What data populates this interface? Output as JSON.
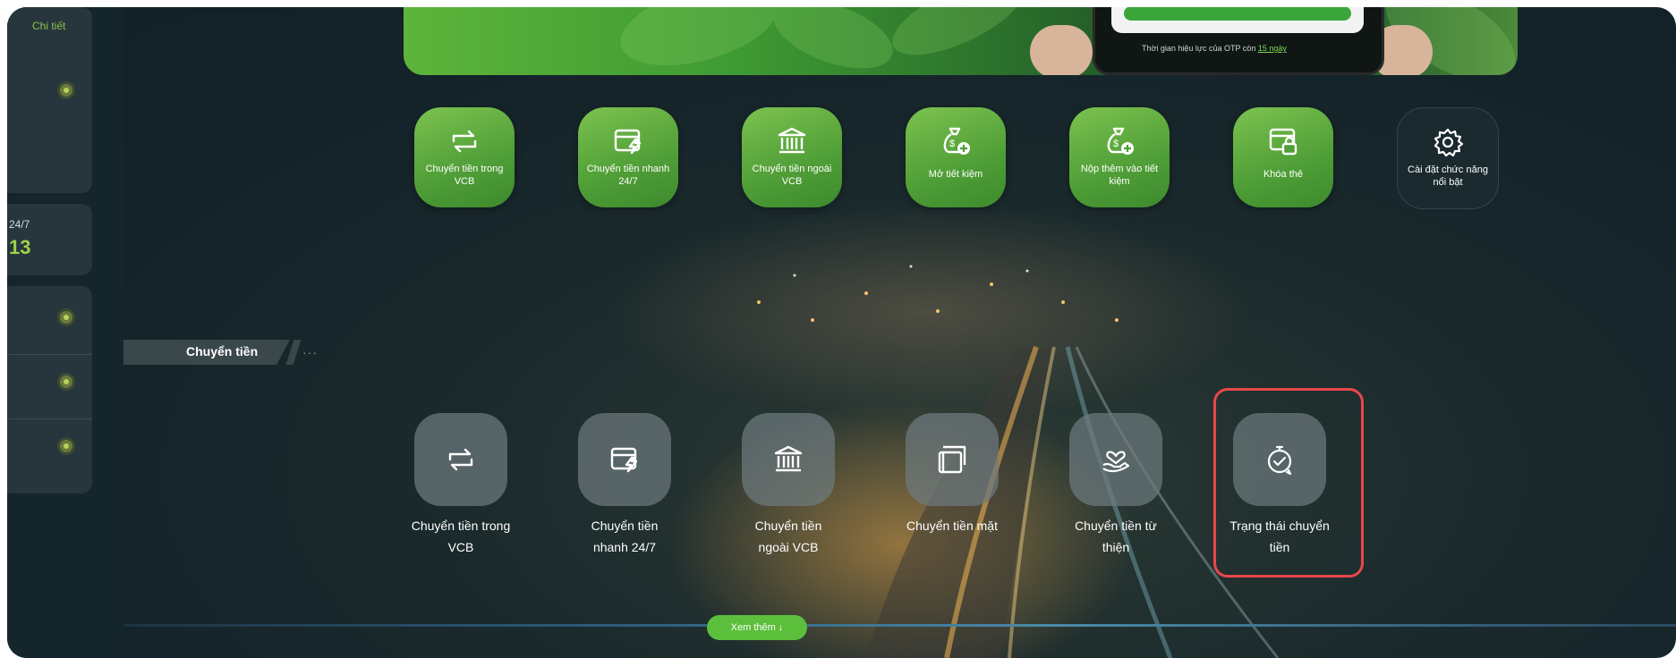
{
  "left_panel": {
    "detail_link": "Chi tiết",
    "label_247": "24/7",
    "value": "13"
  },
  "banner": {
    "otp_text": "Thời gian hiệu lực của OTP còn",
    "otp_time": "15 ngày"
  },
  "featured": [
    {
      "label": "Chuyển tiền trong VCB",
      "icon": "transfer-arrows-icon"
    },
    {
      "label": "Chuyển tiền nhanh 24/7",
      "icon": "fast-card-icon"
    },
    {
      "label": "Chuyển tiền ngoài VCB",
      "icon": "bank-icon"
    },
    {
      "label": "Mở tiết kiệm",
      "icon": "savings-bag-plus-icon"
    },
    {
      "label": "Nộp thêm vào tiết kiệm",
      "icon": "savings-bag-deposit-icon"
    },
    {
      "label": "Khóa thẻ",
      "icon": "card-lock-icon"
    },
    {
      "label": "Cài đặt chức năng nổi bật",
      "icon": "gear-icon"
    }
  ],
  "section": {
    "title": "Chuyển tiền",
    "more_dots": "···"
  },
  "transfer_items": [
    {
      "line1": "Chuyển tiền trong",
      "line2": "VCB",
      "icon": "transfer-arrows-icon"
    },
    {
      "line1": "Chuyển tiền",
      "line2": "nhanh 24/7",
      "icon": "fast-card-icon"
    },
    {
      "line1": "Chuyển tiền",
      "line2": "ngoài VCB",
      "icon": "bank-icon"
    },
    {
      "line1": "Chuyển tiền mặt",
      "line2": "",
      "icon": "cash-card-icon"
    },
    {
      "line1": "Chuyển tiền từ",
      "line2": "thiện",
      "icon": "charity-hands-icon"
    },
    {
      "line1": "Trạng thái chuyển",
      "line2": "tiền",
      "icon": "stopwatch-check-icon"
    }
  ],
  "footer": {
    "see_more": "Xem thêm ↓"
  },
  "colors": {
    "accent_green": "#5cbf3c",
    "highlight_red": "#e8474b"
  }
}
